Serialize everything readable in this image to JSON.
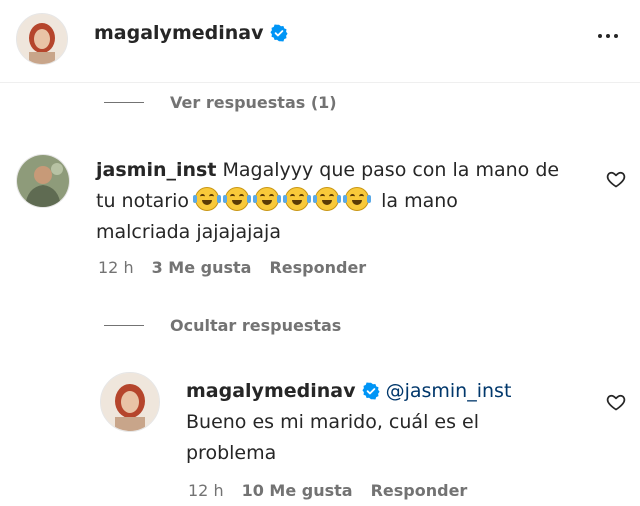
{
  "post_header": {
    "username": "magalymedinav",
    "verified_icon": "verified-badge-icon",
    "more_icon": "more-options-icon"
  },
  "view_replies": {
    "label": "Ver respuestas (1)"
  },
  "comment": {
    "username": "jasmin_inst",
    "line1_text": "Magalyyy que paso con la mano de",
    "line2_prefix": "tu notario",
    "emoji_name": "face-with-tears-of-joy",
    "emoji_count": 6,
    "line2_suffix": "la mano",
    "line3": "malcriada jajajajaja",
    "time": "12 h",
    "likes": "3 Me gusta",
    "reply_label": "Responder"
  },
  "hide_replies": {
    "label": "Ocultar respuestas"
  },
  "reply": {
    "username": "magalymedinav",
    "mention": "@jasmin_inst",
    "line1": "Bueno es mi marido, cuál es el",
    "line2": "problema",
    "time": "12 h",
    "likes": "10 Me gusta",
    "reply_label": "Responder"
  },
  "colors": {
    "text": "#262626",
    "secondary": "#737373",
    "verified": "#0095f6",
    "mention": "#00376b"
  }
}
